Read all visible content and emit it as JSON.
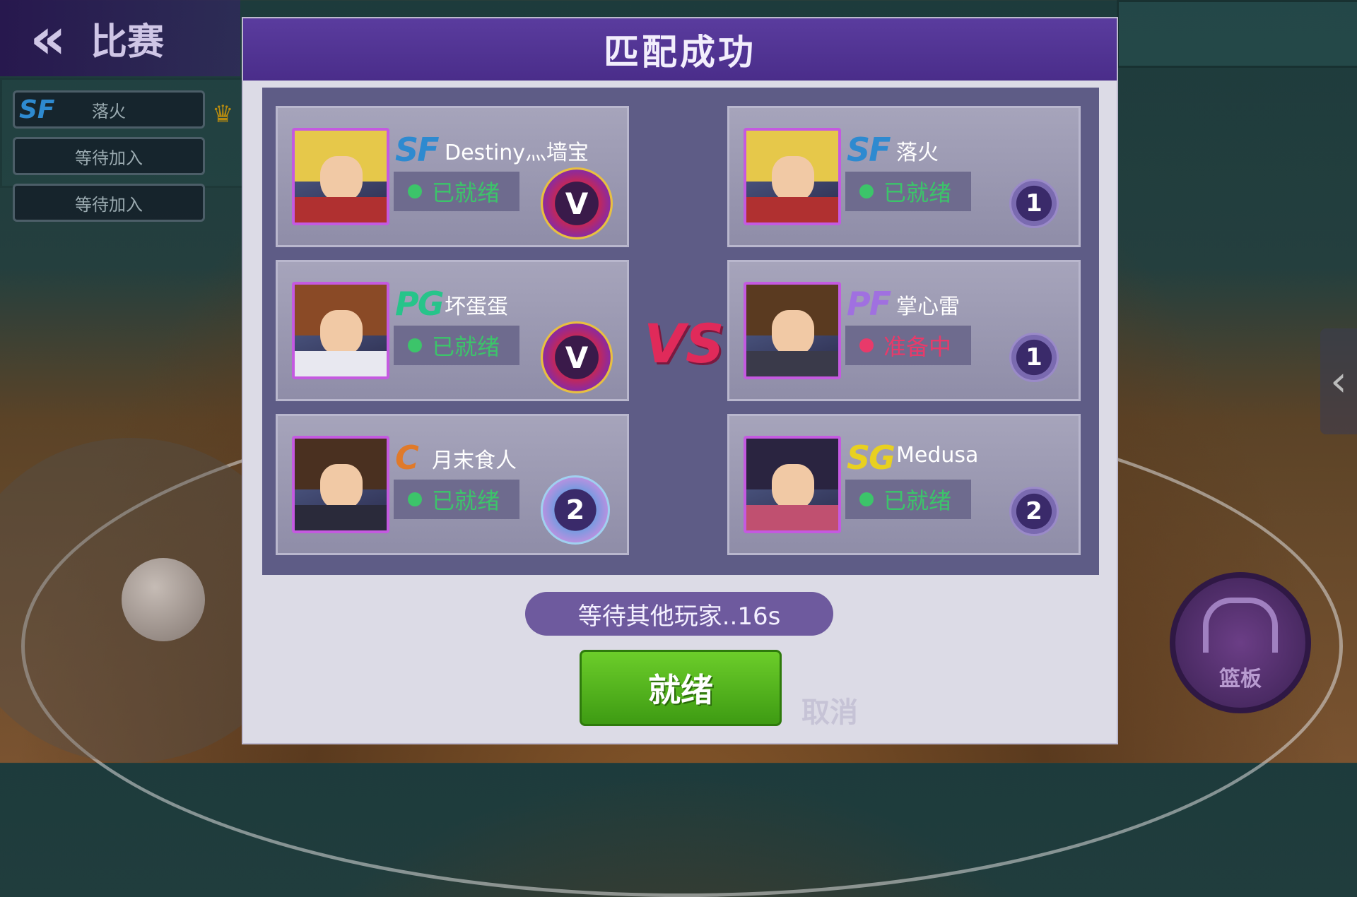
{
  "topbar": {
    "title": "比赛",
    "back_icon": "double-chevron-left-icon"
  },
  "lobby": {
    "slots": [
      {
        "position": "SF",
        "label": "落火"
      },
      {
        "label": "等待加入"
      },
      {
        "label": "等待加入"
      }
    ],
    "crown_icon": "crown-icon"
  },
  "dialog": {
    "title": "匹配成功",
    "vs": "VS",
    "waiting": "等待其他玩家..16s",
    "ready_button": "就绪",
    "cancel_button": "取消"
  },
  "teams": {
    "left": [
      {
        "position": "SF",
        "pos_color": "#2e8ad0",
        "name": "Destiny灬墙宝",
        "status": "已就绪",
        "status_color": "#3cc46a",
        "rank": "V",
        "hair": "#e6c84a",
        "shirt": "#b03030"
      },
      {
        "position": "PG",
        "pos_color": "#27c48a",
        "name": "坏蛋蛋",
        "status": "已就绪",
        "status_color": "#3cc46a",
        "rank": "V",
        "hair": "#8a4a26",
        "shirt": "#e8e8f0"
      },
      {
        "position": "C",
        "pos_color": "#e07a2a",
        "name": "月末食人",
        "status": "已就绪",
        "status_color": "#3cc46a",
        "rank": "2",
        "hair": "#4a3020",
        "shirt": "#2a2a3a"
      }
    ],
    "right": [
      {
        "position": "SF",
        "pos_color": "#2e8ad0",
        "name": "落火",
        "status": "已就绪",
        "status_color": "#3cc46a",
        "rank": "1",
        "hair": "#e6c84a",
        "shirt": "#b03030"
      },
      {
        "position": "PF",
        "pos_color": "#a070e0",
        "name": "掌心雷",
        "status": "准备中",
        "status_color": "#e83a6a",
        "rank": "1",
        "hair": "#5a3a20",
        "shirt": "#3a3a4a"
      },
      {
        "position": "SG",
        "pos_color": "#e8d020",
        "name": "Medusa",
        "status": "已就绪",
        "status_color": "#3cc46a",
        "rank": "2",
        "hair": "#2a2440",
        "shirt": "#c05070"
      }
    ]
  },
  "hud": {
    "rebound_label": "篮板",
    "rebound_icon": "hoop-icon",
    "basketball_icon": "basketball-icon",
    "side_arrow_icon": "chevron-left-icon"
  }
}
